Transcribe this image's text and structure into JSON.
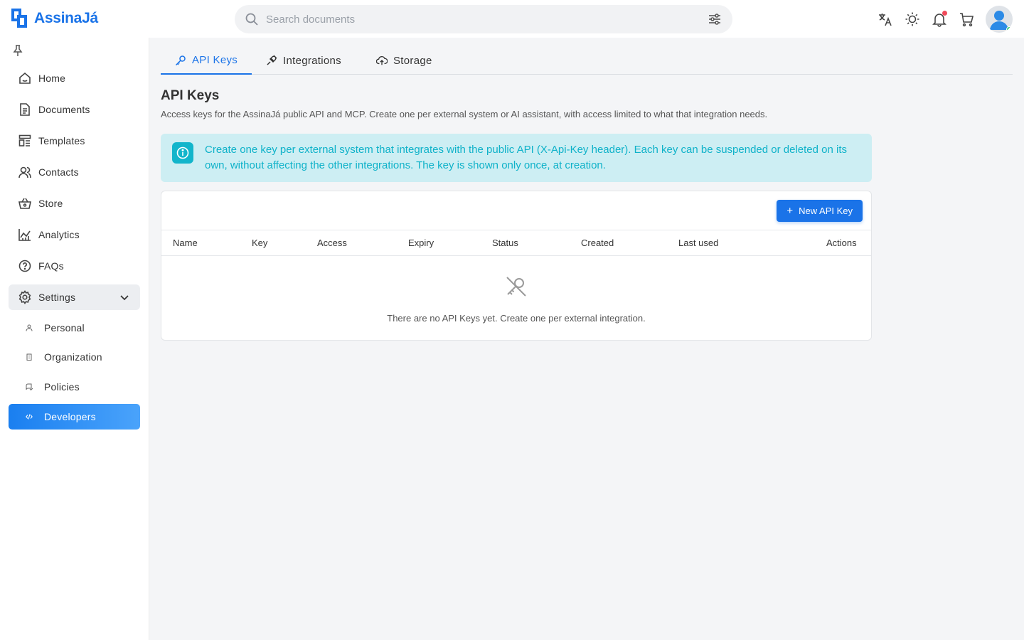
{
  "app": {
    "name": "AssinaJá",
    "brand_color": "#1a73e8"
  },
  "search": {
    "placeholder": "Search documents",
    "value": ""
  },
  "topbar": {
    "icons": [
      "translate-icon",
      "sun-icon",
      "bell-icon",
      "cart-icon"
    ]
  },
  "sidebar": {
    "items": [
      {
        "label": "Home",
        "icon": "home-icon"
      },
      {
        "label": "Documents",
        "icon": "document-icon"
      },
      {
        "label": "Templates",
        "icon": "template-icon"
      },
      {
        "label": "Contacts",
        "icon": "contacts-icon"
      },
      {
        "label": "Store",
        "icon": "store-icon"
      },
      {
        "label": "Analytics",
        "icon": "analytics-icon"
      },
      {
        "label": "FAQs",
        "icon": "help-icon"
      },
      {
        "label": "Settings",
        "icon": "gear-icon",
        "expanded": true
      }
    ],
    "sub_items": [
      {
        "label": "Personal",
        "icon": "person-icon"
      },
      {
        "label": "Organization",
        "icon": "building-icon"
      },
      {
        "label": "Policies",
        "icon": "policy-icon"
      },
      {
        "label": "Developers",
        "icon": "code-icon",
        "active": true
      }
    ]
  },
  "tabs": [
    {
      "label": "API Keys",
      "icon": "key-icon",
      "active": true
    },
    {
      "label": "Integrations",
      "icon": "plug-icon"
    },
    {
      "label": "Storage",
      "icon": "cloud-upload-icon"
    }
  ],
  "page": {
    "title": "API Keys",
    "description": "Access keys for the AssinaJá public API and MCP. Create one per external system or AI assistant, with access limited to what that integration needs."
  },
  "info": {
    "text": "Create one key per external system that integrates with the public API (X-Api-Key header). Each key can be suspended or deleted on its own, without affecting the other integrations. The key is shown only once, at creation.",
    "color": "#12b5cb"
  },
  "table": {
    "new_button": "New API Key",
    "columns": [
      "Name",
      "Key",
      "Access",
      "Expiry",
      "Status",
      "Created",
      "Last used",
      "Actions"
    ],
    "rows": [],
    "empty_text": "There are no API Keys yet. Create one per external integration."
  }
}
